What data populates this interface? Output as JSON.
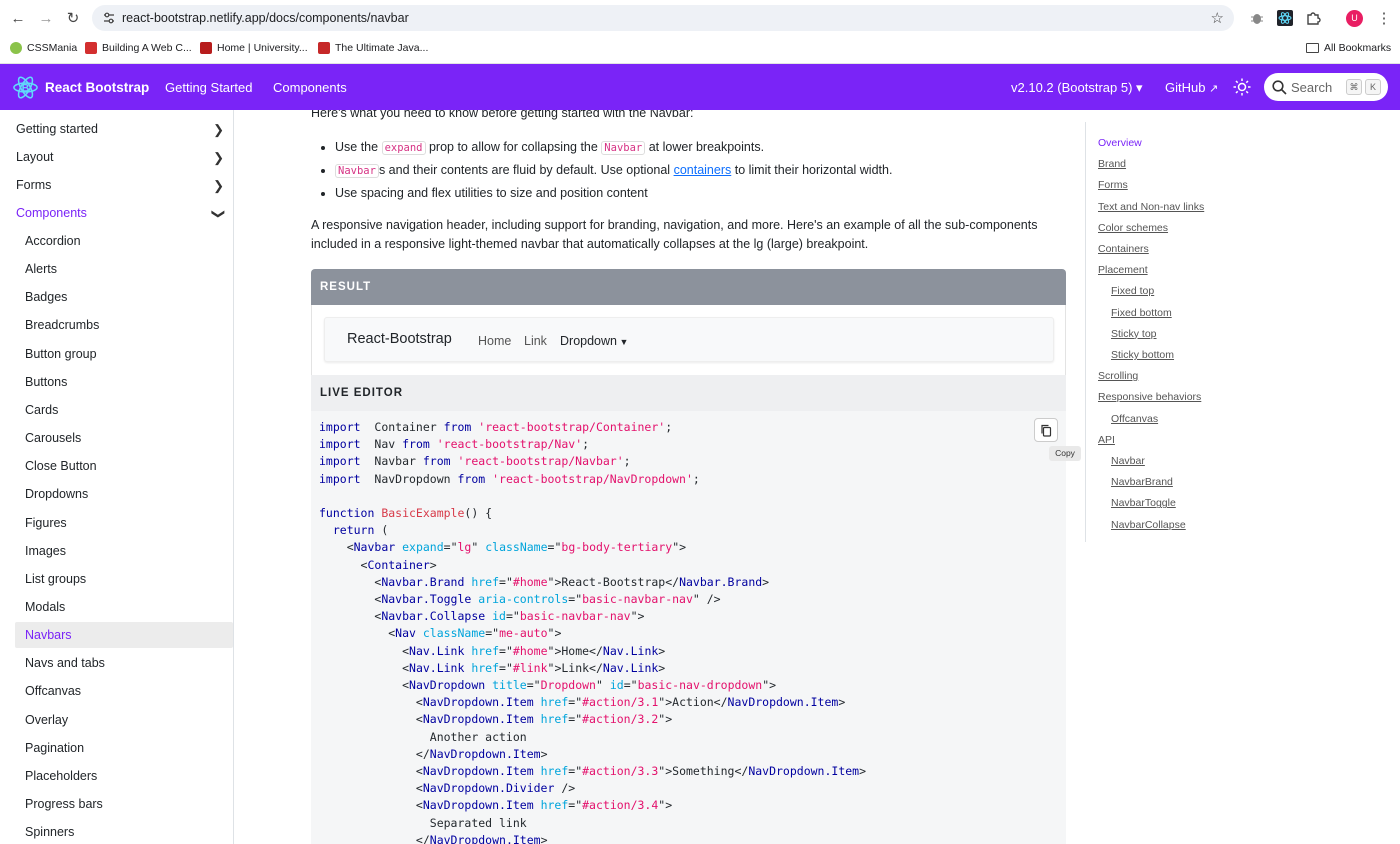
{
  "browser": {
    "url": "react-bootstrap.netlify.app/docs/components/navbar",
    "bookmarks": [
      {
        "label": "CSSMania",
        "color": "#8bc34a"
      },
      {
        "label": "Building A Web C...",
        "color": "#d32f2f"
      },
      {
        "label": "Home | University...",
        "color": "#b71c1c"
      },
      {
        "label": "The Ultimate Java...",
        "color": "#c62828"
      }
    ],
    "all_bookmarks": "All Bookmarks",
    "profile_initial": "U"
  },
  "topnav": {
    "brand": "React Bootstrap",
    "links": [
      "Getting Started",
      "Components"
    ],
    "version": "v2.10.2 (Bootstrap 5)",
    "github": "GitHub",
    "search_placeholder": "Search",
    "kbd1": "⌘",
    "kbd2": "K",
    "accent": "#7a24f7"
  },
  "sidebar": {
    "sections": [
      "Getting started",
      "Layout",
      "Forms",
      "Components"
    ],
    "items": [
      "Accordion",
      "Alerts",
      "Badges",
      "Breadcrumbs",
      "Button group",
      "Buttons",
      "Cards",
      "Carousels",
      "Close Button",
      "Dropdowns",
      "Figures",
      "Images",
      "List groups",
      "Modals",
      "Navbars",
      "Navs and tabs",
      "Offcanvas",
      "Overlay",
      "Pagination",
      "Placeholders",
      "Progress bars",
      "Spinners"
    ],
    "active_item": "Navbars"
  },
  "content": {
    "intro_partial": "Here's what you need to know before getting started with the Navbar:",
    "bullet1_a": "Use the ",
    "bullet1_code1": "expand",
    "bullet1_b": " prop to allow for collapsing the ",
    "bullet1_code2": "Navbar",
    "bullet1_c": " at lower breakpoints.",
    "bullet2_code": "Navbar",
    "bullet2_a": "s and their contents are fluid by default. Use optional ",
    "bullet2_link": "containers",
    "bullet2_b": " to limit their horizontal width.",
    "bullet3": "Use spacing and flex utilities to size and position content",
    "desc_line1": "A responsive navigation header, including support for branding, navigation, and more. Here's an example of all the sub-components",
    "desc_line2": "included in a responsive light-themed navbar that automatically collapses at the lg (large) breakpoint.",
    "result_label": "RESULT",
    "demo_brand": "React-Bootstrap",
    "demo_links": [
      "Home",
      "Link",
      "Dropdown"
    ],
    "live_editor_label": "LIVE EDITOR",
    "copy_tooltip": "Copy"
  },
  "toc": {
    "items": [
      {
        "label": "Overview",
        "indent": false,
        "selected": true
      },
      {
        "label": "Brand",
        "indent": false
      },
      {
        "label": "Forms",
        "indent": false
      },
      {
        "label": "Text and Non-nav links",
        "indent": false
      },
      {
        "label": "Color schemes",
        "indent": false
      },
      {
        "label": "Containers",
        "indent": false
      },
      {
        "label": "Placement",
        "indent": false
      },
      {
        "label": "Fixed top",
        "indent": true
      },
      {
        "label": "Fixed bottom",
        "indent": true
      },
      {
        "label": "Sticky top",
        "indent": true
      },
      {
        "label": "Sticky bottom",
        "indent": true
      },
      {
        "label": "Scrolling",
        "indent": false
      },
      {
        "label": "Responsive behaviors",
        "indent": false
      },
      {
        "label": "Offcanvas",
        "indent": true
      },
      {
        "label": "API",
        "indent": false
      },
      {
        "label": "Navbar",
        "indent": true
      },
      {
        "label": "NavbarBrand",
        "indent": true
      },
      {
        "label": "NavbarToggle",
        "indent": true
      },
      {
        "label": "NavbarCollapse",
        "indent": true
      }
    ]
  },
  "code_lines": [
    [
      [
        "kw",
        "import"
      ],
      [
        "",
        "  Container "
      ],
      [
        "kw",
        "from"
      ],
      [
        "st",
        " 'react-bootstrap/Container'"
      ],
      [
        "",
        ";"
      ]
    ],
    [
      [
        "kw",
        "import"
      ],
      [
        "",
        "  Nav "
      ],
      [
        "kw",
        "from"
      ],
      [
        "st",
        " 'react-bootstrap/Nav'"
      ],
      [
        "",
        ";"
      ]
    ],
    [
      [
        "kw",
        "import"
      ],
      [
        "",
        "  Navbar "
      ],
      [
        "kw",
        "from"
      ],
      [
        "st",
        " 'react-bootstrap/Navbar'"
      ],
      [
        "",
        ";"
      ]
    ],
    [
      [
        "kw",
        "import"
      ],
      [
        "",
        "  NavDropdown "
      ],
      [
        "kw",
        "from"
      ],
      [
        "st",
        " 'react-bootstrap/NavDropdown'"
      ],
      [
        "",
        ";"
      ]
    ],
    [
      [
        "",
        ""
      ]
    ],
    [
      [
        "kw",
        "function"
      ],
      [
        "fn",
        " BasicExample"
      ],
      [
        "",
        "() {"
      ]
    ],
    [
      [
        "",
        "  "
      ],
      [
        "kw",
        "return"
      ],
      [
        "",
        " ("
      ]
    ],
    [
      [
        "",
        "    <"
      ],
      [
        "tg",
        "Navbar"
      ],
      [
        "at",
        " expand"
      ],
      [
        "",
        "=\""
      ],
      [
        "st",
        "lg"
      ],
      [
        "",
        "\""
      ],
      [
        "at",
        " className"
      ],
      [
        "",
        "=\""
      ],
      [
        "st",
        "bg-body-tertiary"
      ],
      [
        "",
        "\">"
      ]
    ],
    [
      [
        "",
        "      <"
      ],
      [
        "tg",
        "Container"
      ],
      [
        "",
        ">"
      ]
    ],
    [
      [
        "",
        "        <"
      ],
      [
        "tg",
        "Navbar.Brand"
      ],
      [
        "at",
        " href"
      ],
      [
        "",
        "=\""
      ],
      [
        "st",
        "#home"
      ],
      [
        "",
        "\">React-Bootstrap</"
      ],
      [
        "tg",
        "Navbar.Brand"
      ],
      [
        "",
        ">"
      ]
    ],
    [
      [
        "",
        "        <"
      ],
      [
        "tg",
        "Navbar.Toggle"
      ],
      [
        "at",
        " aria-controls"
      ],
      [
        "",
        "=\""
      ],
      [
        "st",
        "basic-navbar-nav"
      ],
      [
        "",
        "\" />"
      ]
    ],
    [
      [
        "",
        "        <"
      ],
      [
        "tg",
        "Navbar.Collapse"
      ],
      [
        "at",
        " id"
      ],
      [
        "",
        "=\""
      ],
      [
        "st",
        "basic-navbar-nav"
      ],
      [
        "",
        "\">"
      ]
    ],
    [
      [
        "",
        "          <"
      ],
      [
        "tg",
        "Nav"
      ],
      [
        "at",
        " className"
      ],
      [
        "",
        "=\""
      ],
      [
        "st",
        "me-auto"
      ],
      [
        "",
        "\">"
      ]
    ],
    [
      [
        "",
        "            <"
      ],
      [
        "tg",
        "Nav.Link"
      ],
      [
        "at",
        " href"
      ],
      [
        "",
        "=\""
      ],
      [
        "st",
        "#home"
      ],
      [
        "",
        "\">Home</"
      ],
      [
        "tg",
        "Nav.Link"
      ],
      [
        "",
        ">"
      ]
    ],
    [
      [
        "",
        "            <"
      ],
      [
        "tg",
        "Nav.Link"
      ],
      [
        "at",
        " href"
      ],
      [
        "",
        "=\""
      ],
      [
        "st",
        "#link"
      ],
      [
        "",
        "\">Link</"
      ],
      [
        "tg",
        "Nav.Link"
      ],
      [
        "",
        ">"
      ]
    ],
    [
      [
        "",
        "            <"
      ],
      [
        "tg",
        "NavDropdown"
      ],
      [
        "at",
        " title"
      ],
      [
        "",
        "=\""
      ],
      [
        "st",
        "Dropdown"
      ],
      [
        "",
        "\""
      ],
      [
        "at",
        " id"
      ],
      [
        "",
        "=\""
      ],
      [
        "st",
        "basic-nav-dropdown"
      ],
      [
        "",
        "\">"
      ]
    ],
    [
      [
        "",
        "              <"
      ],
      [
        "tg",
        "NavDropdown.Item"
      ],
      [
        "at",
        " href"
      ],
      [
        "",
        "=\""
      ],
      [
        "st",
        "#action/3.1"
      ],
      [
        "",
        "\">Action</"
      ],
      [
        "tg",
        "NavDropdown.Item"
      ],
      [
        "",
        ">"
      ]
    ],
    [
      [
        "",
        "              <"
      ],
      [
        "tg",
        "NavDropdown.Item"
      ],
      [
        "at",
        " href"
      ],
      [
        "",
        "=\""
      ],
      [
        "st",
        "#action/3.2"
      ],
      [
        "",
        "\">"
      ]
    ],
    [
      [
        "",
        "                Another action"
      ]
    ],
    [
      [
        "",
        "              </"
      ],
      [
        "tg",
        "NavDropdown.Item"
      ],
      [
        "",
        ">"
      ]
    ],
    [
      [
        "",
        "              <"
      ],
      [
        "tg",
        "NavDropdown.Item"
      ],
      [
        "at",
        " href"
      ],
      [
        "",
        "=\""
      ],
      [
        "st",
        "#action/3.3"
      ],
      [
        "",
        "\">Something</"
      ],
      [
        "tg",
        "NavDropdown.Item"
      ],
      [
        "",
        ">"
      ]
    ],
    [
      [
        "",
        "              <"
      ],
      [
        "tg",
        "NavDropdown.Divider"
      ],
      [
        "",
        " />"
      ]
    ],
    [
      [
        "",
        "              <"
      ],
      [
        "tg",
        "NavDropdown.Item"
      ],
      [
        "at",
        " href"
      ],
      [
        "",
        "=\""
      ],
      [
        "st",
        "#action/3.4"
      ],
      [
        "",
        "\">"
      ]
    ],
    [
      [
        "",
        "                Separated link"
      ]
    ],
    [
      [
        "",
        "              </"
      ],
      [
        "tg",
        "NavDropdown.Item"
      ],
      [
        "",
        ">"
      ]
    ]
  ]
}
